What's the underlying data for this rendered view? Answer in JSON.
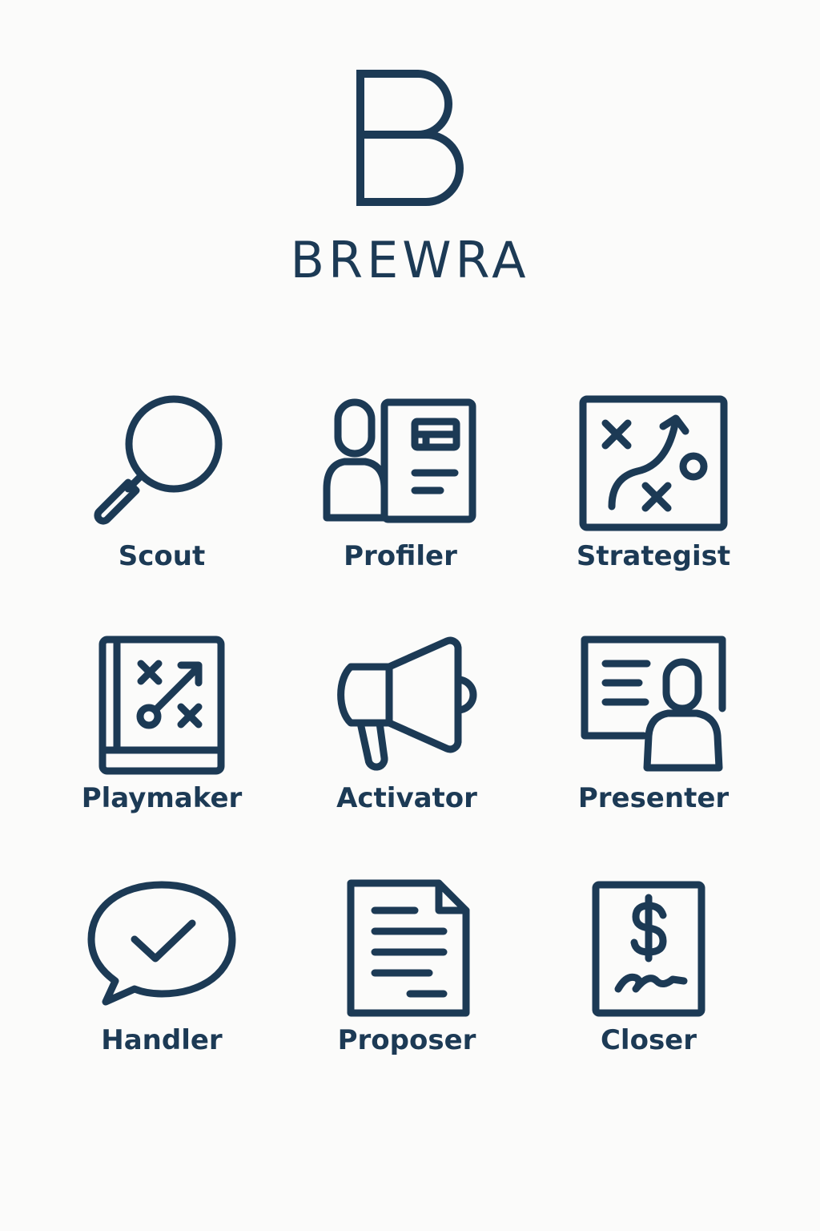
{
  "brand": {
    "name": "BREWRA",
    "logo_icon": "letter-b-logo"
  },
  "roles": [
    {
      "label": "Scout",
      "icon": "magnifying-glass-icon"
    },
    {
      "label": "Profiler",
      "icon": "person-profile-card-icon"
    },
    {
      "label": "Strategist",
      "icon": "strategy-board-icon"
    },
    {
      "label": "Playmaker",
      "icon": "playbook-icon"
    },
    {
      "label": "Activator",
      "icon": "megaphone-icon"
    },
    {
      "label": "Presenter",
      "icon": "presentation-screen-icon"
    },
    {
      "label": "Handler",
      "icon": "speech-bubble-check-icon"
    },
    {
      "label": "Proposer",
      "icon": "document-icon"
    },
    {
      "label": "Closer",
      "icon": "signed-invoice-icon"
    }
  ],
  "colors": {
    "primary": "#1c3a55",
    "background": "#fbfbfa"
  }
}
